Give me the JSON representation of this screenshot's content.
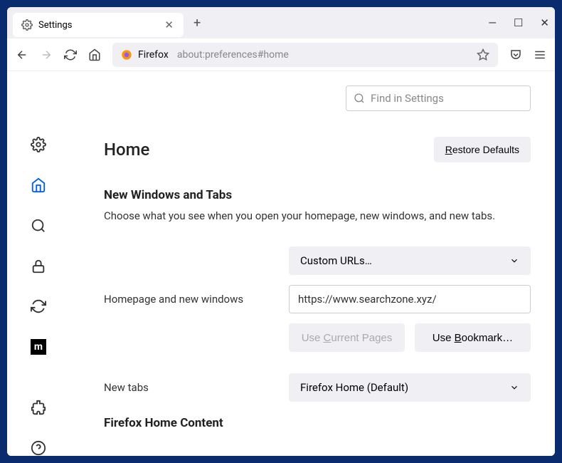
{
  "tab": {
    "title": "Settings"
  },
  "urlbar": {
    "brand": "Firefox",
    "url": "about:preferences#home"
  },
  "search": {
    "placeholder": "Find in Settings"
  },
  "page": {
    "title": "Home",
    "restore": "Restore Defaults",
    "section1_title": "New Windows and Tabs",
    "section1_desc": "Choose what you see when you open your homepage, new windows, and new tabs.",
    "homepage_label": "Homepage and new windows",
    "homepage_select": "Custom URLs…",
    "homepage_value": "https://www.searchzone.xyz/",
    "use_current": "Use Current Pages",
    "use_bookmark": "Use Bookmark…",
    "newtabs_label": "New tabs",
    "newtabs_select": "Firefox Home (Default)",
    "section2_title": "Firefox Home Content"
  }
}
